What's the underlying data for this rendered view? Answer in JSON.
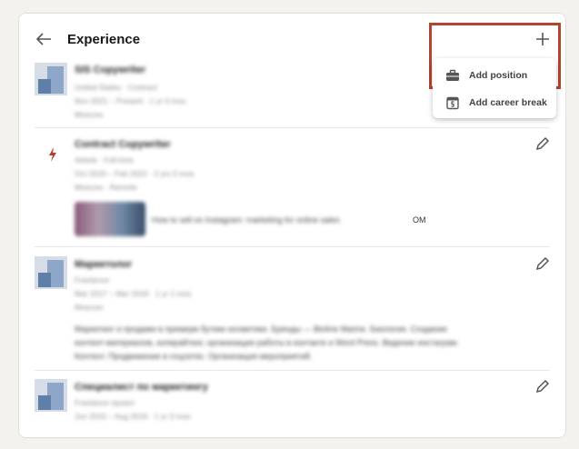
{
  "header": {
    "title": "Experience"
  },
  "menu": {
    "items": [
      {
        "label": "Add position"
      },
      {
        "label": "Add career break"
      }
    ]
  },
  "entries": [
    {
      "title": "SIS Copywriter",
      "company": "United States · Contract",
      "dates": "Nov 2021 – Present · 1 yr 4 mos",
      "location": "Moscow"
    },
    {
      "title": "Contract Copywriter",
      "company": "Airbnb · Full-time",
      "dates": "Oct 2019 – Feb 2022 · 2 yrs 5 mos",
      "location": "Moscow · Remote",
      "media_caption": "How to sell on Instagram: marketing for online sales",
      "media_caption_tail": "OM"
    },
    {
      "title": "Маркетолог",
      "company": "Freelance",
      "dates": "Mar 2017 – Mar 2018 · 1 yr 1 mos",
      "location": "Moscow",
      "description_1": "Маркетинг и продажи в премиум бутике косметики. Бренды — Bioline Marine. Биология. Создание",
      "description_2": "контент-материалов, копирайтинг, организация работы в контакте и Word Press. Ведение инстаграм.",
      "description_3": "Контент. Продвижение в соцсетях. Организация мероприятий."
    },
    {
      "title": "Специалист по маркетингу",
      "company": "Freelance проект",
      "dates": "Jun 2015 – Aug 2016 · 1 yr 3 mos",
      "location": ""
    }
  ]
}
